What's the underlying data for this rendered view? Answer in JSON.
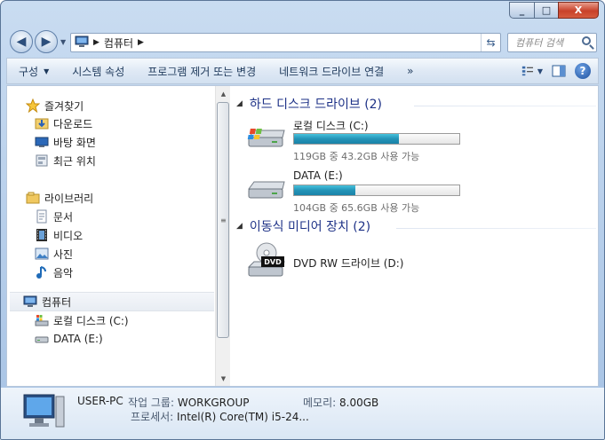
{
  "window": {
    "caption_min": "_",
    "caption_max": "□",
    "caption_close": "X"
  },
  "address": {
    "crumb": "컴퓨터",
    "search_placeholder": "컴퓨터 검색"
  },
  "toolbar": {
    "organize": "구성",
    "system_props": "시스템 속성",
    "uninstall": "프로그램 제거 또는 변경",
    "map_drive": "네트워크 드라이브 연결",
    "more": "»",
    "help": "?"
  },
  "nav": {
    "favorites": "즐겨찾기",
    "downloads": "다운로드",
    "desktop": "바탕 화면",
    "recent": "최근 위치",
    "libraries": "라이브러리",
    "documents": "문서",
    "videos": "비디오",
    "pictures": "사진",
    "music": "음악",
    "computer": "컴퓨터",
    "local_c": "로컬 디스크 (C:)",
    "data_e": "DATA (E:)"
  },
  "groups": {
    "hdd": "하드 디스크 드라이브 (2)",
    "removable": "이동식 미디어 장치 (2)"
  },
  "drives": [
    {
      "name": "로컬 디스크 (C:)",
      "space": "119GB 중 43.2GB 사용 가능",
      "used_fraction": 0.637
    },
    {
      "name": "DATA (E:)",
      "space": "104GB 중 65.6GB 사용 가능",
      "used_fraction": 0.37
    },
    {
      "name": "DVD RW 드라이브 (D:)",
      "icon_label": "DVD"
    }
  ],
  "details": {
    "pc_name": "USER-PC",
    "workgroup_label": "작업 그룹:",
    "workgroup": "WORKGROUP",
    "memory_label": "메모리:",
    "memory": "8.00GB",
    "cpu_label": "프로세서:",
    "cpu": "Intel(R) Core(TM) i5-24..."
  },
  "colors": {
    "accent": "#1e3287",
    "bar_fill": "#2393b7",
    "close_button": "#c8412a"
  }
}
